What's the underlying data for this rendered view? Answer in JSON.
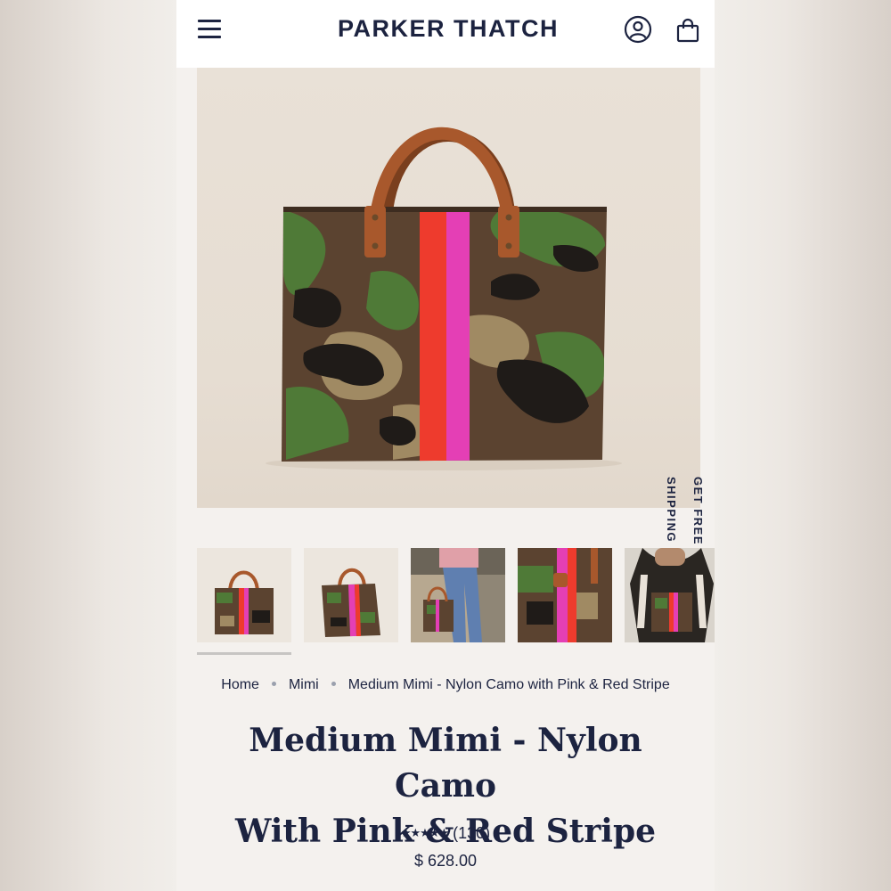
{
  "header": {
    "brand": "PARKER THATCH",
    "menu_icon": "hamburger-menu-icon",
    "account_icon": "account-icon",
    "cart_icon": "shopping-bag-icon"
  },
  "promo": {
    "line1": "GET FREE",
    "line2": "SHIPPING"
  },
  "gallery": {
    "main_image": "camo-tote-with-pink-and-red-stripe",
    "thumbnails": [
      "tote-front",
      "tote-angle",
      "tote-worn-by-model",
      "tote-detail",
      "tote-held-by-model"
    ],
    "active_index": 0
  },
  "breadcrumb": [
    "Home",
    "Mimi",
    "Medium Mimi - Nylon Camo with Pink & Red Stripe"
  ],
  "product": {
    "title_line1": "Medium Mimi - Nylon Camo",
    "title_line2": "With Pink & Red Stripe",
    "stars": "★★★★★",
    "review_count": "(130)",
    "rating": 5,
    "price": "$ 628.00"
  },
  "colors": {
    "navy": "#1c2340",
    "camo_brown": "#5b4330",
    "camo_green": "#4f7a37",
    "camo_tan": "#a08a63",
    "stripe_red": "#ee3b2d",
    "stripe_pink": "#e43fb5",
    "leather": "#a8582c"
  }
}
